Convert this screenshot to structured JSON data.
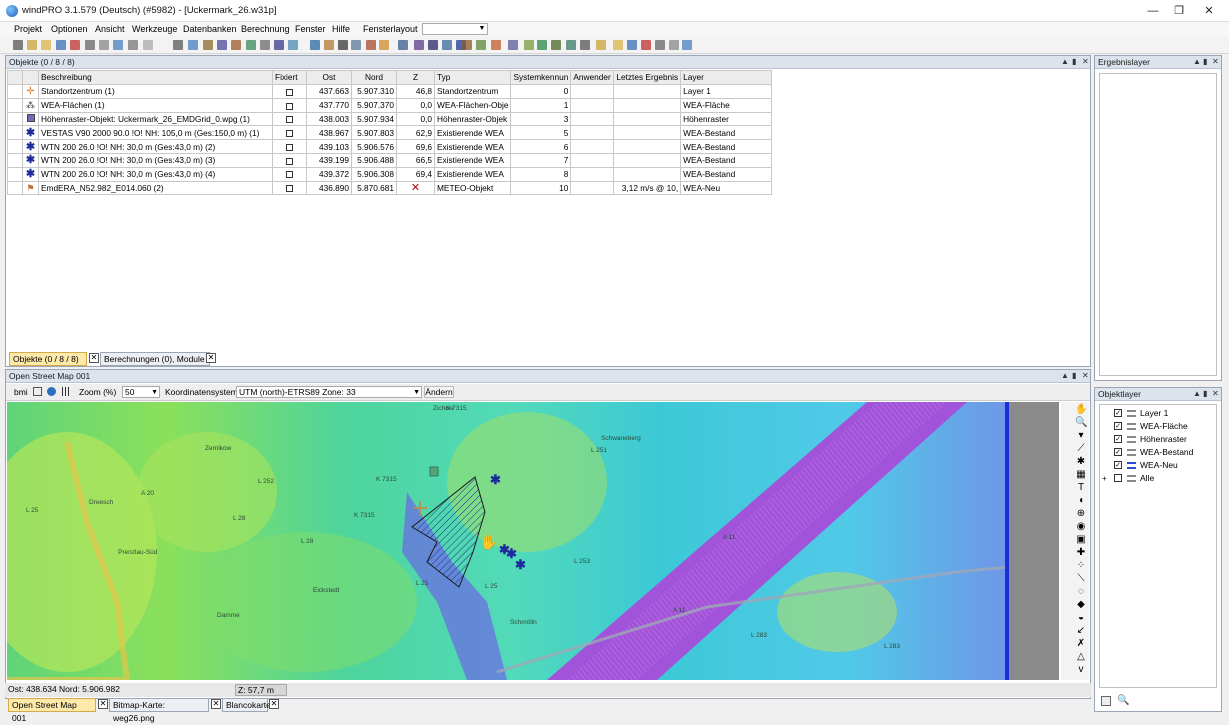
{
  "window": {
    "title": "windPRO 3.1.579 (Deutsch) (#5982) - [Uckermark_26.w31p]",
    "min": "—",
    "max": "❐",
    "close": "✕"
  },
  "menu": [
    "Projekt",
    "Optionen",
    "Ansicht",
    "Werkzeuge",
    "Datenbanken",
    "Berechnung",
    "Fenster",
    "Hilfe",
    "Fensterlayout"
  ],
  "objects": {
    "header": "Objekte (0 / 8 / 8)",
    "columns": [
      "Beschreibung",
      "Fixiert",
      "Ost",
      "Nord",
      "Z",
      "Typ",
      "Systemkennun",
      "Anwender",
      "Letztes Ergebnis",
      "Layer"
    ],
    "rows": [
      {
        "icon": "site-center-icon",
        "desc": "Standortzentrum (1)",
        "ost": "437.663",
        "nord": "5.907.310",
        "z": "46,8",
        "typ": "Standortzentrum",
        "sys": "0",
        "anw": "",
        "res": "",
        "layer": "Layer 1"
      },
      {
        "icon": "area-icon",
        "desc": "WEA-Flächen (1)",
        "ost": "437.770",
        "nord": "5.907.370",
        "z": "0,0",
        "typ": "WEA-Flächen-Obje",
        "sys": "1",
        "anw": "",
        "res": "",
        "layer": "WEA-Fläche"
      },
      {
        "icon": "raster-icon",
        "desc": "Höhenraster-Objekt: Uckermark_26_EMDGrid_0.wpg (1)",
        "ost": "438.003",
        "nord": "5.907.934",
        "z": "0,0",
        "typ": "Höhenraster-Objek",
        "sys": "3",
        "anw": "",
        "res": "",
        "layer": "Höhenraster"
      },
      {
        "icon": "turbine-icon",
        "desc": "VESTAS V90 2000 90.0 !O! NH: 105,0 m (Ges:150,0 m) (1)",
        "ost": "438.967",
        "nord": "5.907.803",
        "z": "62,9",
        "typ": "Existierende WEA",
        "sys": "5",
        "anw": "",
        "res": "",
        "layer": "WEA-Bestand"
      },
      {
        "icon": "turbine-icon",
        "desc": "WTN  200 26.0 !O! NH: 30,0 m (Ges:43,0 m) (2)",
        "ost": "439.103",
        "nord": "5.906.576",
        "z": "69,6",
        "typ": "Existierende WEA",
        "sys": "6",
        "anw": "",
        "res": "",
        "layer": "WEA-Bestand"
      },
      {
        "icon": "turbine-icon",
        "desc": "WTN  200 26.0 !O! NH: 30,0 m (Ges:43,0 m) (3)",
        "ost": "439.199",
        "nord": "5.906.488",
        "z": "66,5",
        "typ": "Existierende WEA",
        "sys": "7",
        "anw": "",
        "res": "",
        "layer": "WEA-Bestand"
      },
      {
        "icon": "turbine-icon",
        "desc": "WTN  200 26.0 !O! NH: 30,0 m (Ges:43,0 m) (4)",
        "ost": "439.372",
        "nord": "5.906.308",
        "z": "69,4",
        "typ": "Existierende WEA",
        "sys": "8",
        "anw": "",
        "res": "",
        "layer": "WEA-Bestand"
      },
      {
        "icon": "meteo-icon",
        "desc": "EmdERA_N52.982_E014.060 (2)",
        "ost": "436.890",
        "nord": "5.870.681",
        "z": "✕",
        "typ": "METEO-Objekt",
        "sys": "10",
        "anw": "",
        "res": "3,12 m/s @ 10,",
        "layer": "WEA-Neu"
      }
    ],
    "tabs": [
      "Objekte (0 / 8 / 8)",
      "Berechnungen (0), Module"
    ]
  },
  "results_panel": {
    "header": "Ergebnislayer"
  },
  "layers_panel": {
    "header": "Objektlayer",
    "items": [
      {
        "label": "Layer 1",
        "checked": "✓"
      },
      {
        "label": "WEA-Fläche",
        "checked": "✓"
      },
      {
        "label": "Höhenraster",
        "checked": "✓"
      },
      {
        "label": "WEA-Bestand",
        "checked": "✓"
      },
      {
        "label": "WEA-Neu",
        "checked": "✓"
      },
      {
        "label": "Alle",
        "checked": ""
      }
    ]
  },
  "map": {
    "header": "Open Street Map 001",
    "toolbar": {
      "bmi": "bmi",
      "zoom_label": "Zoom (%)",
      "zoom_value": "50",
      "coord_label": "Koordinatensystem",
      "coord_value": "UTM (north)-ETRS89 Zone: 33",
      "change": "Ändern"
    },
    "labels": [
      "Zichow",
      "Zernikow",
      "Dreesch",
      "Prenzlau-Süd",
      "Damme",
      "Eickstedt",
      "Schmölln",
      "Schwaneberg",
      "A 20",
      "A 11",
      "A 11",
      "L 25",
      "L 25",
      "L 25",
      "L 28",
      "L 28",
      "L 283",
      "L 283",
      "L 251",
      "L 252",
      "L 253",
      "K 7315",
      "K 7315",
      "K 7315"
    ],
    "status": {
      "coords": "Ost: 438.634  Nord: 5.906.982",
      "z": "Z: 57,7 m"
    },
    "tabs": [
      "Open Street Map 001",
      "Bitmap-Karte: weg26.png",
      "Blancokarte"
    ]
  },
  "colors": {
    "accent": "#fde9a9",
    "panel_border": "#9aa6b6",
    "turbine": "#1c2a9c",
    "highway": "#b25bd8"
  }
}
